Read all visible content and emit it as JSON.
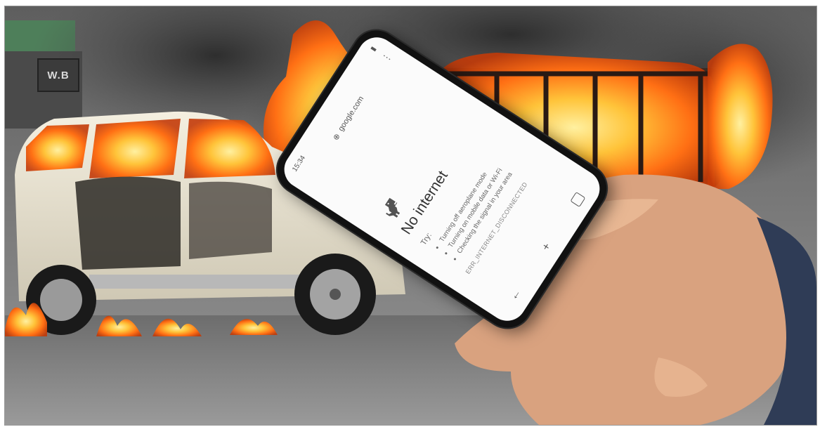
{
  "scene": {
    "sign_text": "W.B",
    "colors": {
      "fire": "#ff7a1a",
      "fire_core": "#ffd34d",
      "smoke": "#3a3a3a",
      "car_body": "#e9e4d6",
      "road": "#7c7c7c"
    }
  },
  "phone": {
    "status_time": "15:34",
    "url": "google.com",
    "menu_icon": "more-vert-icon",
    "dino_icon": "offline-dino-icon",
    "error_title": "No internet",
    "try_label": "Try:",
    "tips": [
      "Turning off aeroplane mode",
      "Turning on mobile data or Wi-Fi",
      "Checking the signal in your area"
    ],
    "error_code": "ERR_INTERNET_DISCONNECTED",
    "bottom_nav": {
      "back_icon": "back-arrow-icon",
      "add_icon": "plus-icon",
      "tabs_icon": "tab-switcher-icon"
    }
  }
}
